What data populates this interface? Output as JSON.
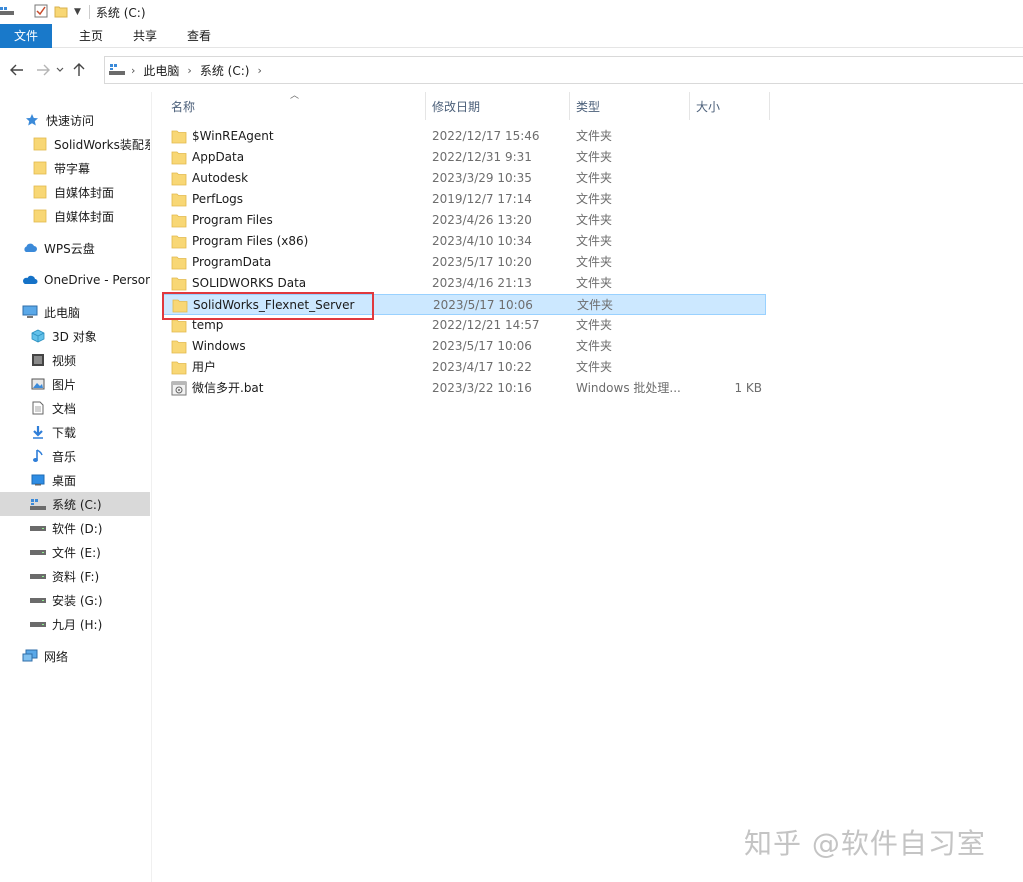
{
  "window": {
    "title": "系统 (C:)"
  },
  "ribbon": {
    "tabs": [
      "文件",
      "主页",
      "共享",
      "查看"
    ]
  },
  "address": {
    "crumbs": [
      "此电脑",
      "系统 (C:)"
    ]
  },
  "columns": {
    "name": "名称",
    "date": "修改日期",
    "type": "类型",
    "size": "大小"
  },
  "sidebar": {
    "items": [
      {
        "label": "快速访问",
        "icon": "star-icon"
      },
      {
        "label": "SolidWorks装配系",
        "icon": "folder-icon"
      },
      {
        "label": "带字幕",
        "icon": "folder-icon"
      },
      {
        "label": "自媒体封面",
        "icon": "folder-icon"
      },
      {
        "label": "自媒体封面",
        "icon": "folder-icon"
      },
      {
        "label": "WPS云盘",
        "icon": "cloud-icon"
      },
      {
        "label": "OneDrive - Person",
        "icon": "onedrive-icon"
      },
      {
        "label": "此电脑",
        "icon": "computer-icon"
      },
      {
        "label": "3D 对象",
        "icon": "cube-icon"
      },
      {
        "label": "视频",
        "icon": "film-icon"
      },
      {
        "label": "图片",
        "icon": "picture-icon"
      },
      {
        "label": "文档",
        "icon": "document-icon"
      },
      {
        "label": "下载",
        "icon": "download-icon"
      },
      {
        "label": "音乐",
        "icon": "music-icon"
      },
      {
        "label": "桌面",
        "icon": "desktop-icon"
      },
      {
        "label": "系统 (C:)",
        "icon": "system-drive-icon"
      },
      {
        "label": "软件 (D:)",
        "icon": "drive-icon"
      },
      {
        "label": "文件 (E:)",
        "icon": "drive-icon"
      },
      {
        "label": "资料 (F:)",
        "icon": "drive-icon"
      },
      {
        "label": "安装 (G:)",
        "icon": "drive-icon"
      },
      {
        "label": "九月 (H:)",
        "icon": "drive-icon"
      },
      {
        "label": "网络",
        "icon": "network-icon"
      }
    ]
  },
  "files": [
    {
      "name": "$WinREAgent",
      "date": "2022/12/17 15:46",
      "type": "文件夹",
      "size": ""
    },
    {
      "name": "AppData",
      "date": "2022/12/31 9:31",
      "type": "文件夹",
      "size": ""
    },
    {
      "name": "Autodesk",
      "date": "2023/3/29 10:35",
      "type": "文件夹",
      "size": ""
    },
    {
      "name": "PerfLogs",
      "date": "2019/12/7 17:14",
      "type": "文件夹",
      "size": ""
    },
    {
      "name": "Program Files",
      "date": "2023/4/26 13:20",
      "type": "文件夹",
      "size": ""
    },
    {
      "name": "Program Files (x86)",
      "date": "2023/4/10 10:34",
      "type": "文件夹",
      "size": ""
    },
    {
      "name": "ProgramData",
      "date": "2023/5/17 10:20",
      "type": "文件夹",
      "size": ""
    },
    {
      "name": "SOLIDWORKS Data",
      "date": "2023/4/16 21:13",
      "type": "文件夹",
      "size": ""
    },
    {
      "name": "SolidWorks_Flexnet_Server",
      "date": "2023/5/17 10:06",
      "type": "文件夹",
      "size": ""
    },
    {
      "name": "temp",
      "date": "2022/12/21 14:57",
      "type": "文件夹",
      "size": ""
    },
    {
      "name": "Windows",
      "date": "2023/5/17 10:06",
      "type": "文件夹",
      "size": ""
    },
    {
      "name": "用户",
      "date": "2023/4/17 10:22",
      "type": "文件夹",
      "size": ""
    },
    {
      "name": "微信多开.bat",
      "date": "2023/3/22 10:16",
      "type": "Windows 批处理...",
      "size": "1 KB"
    }
  ],
  "watermark": "知乎 @软件自习室",
  "colors": {
    "accent": "#1979ca",
    "selected_row": "#cce8ff",
    "highlight": "#e0393e",
    "folder": "#f8d775"
  }
}
